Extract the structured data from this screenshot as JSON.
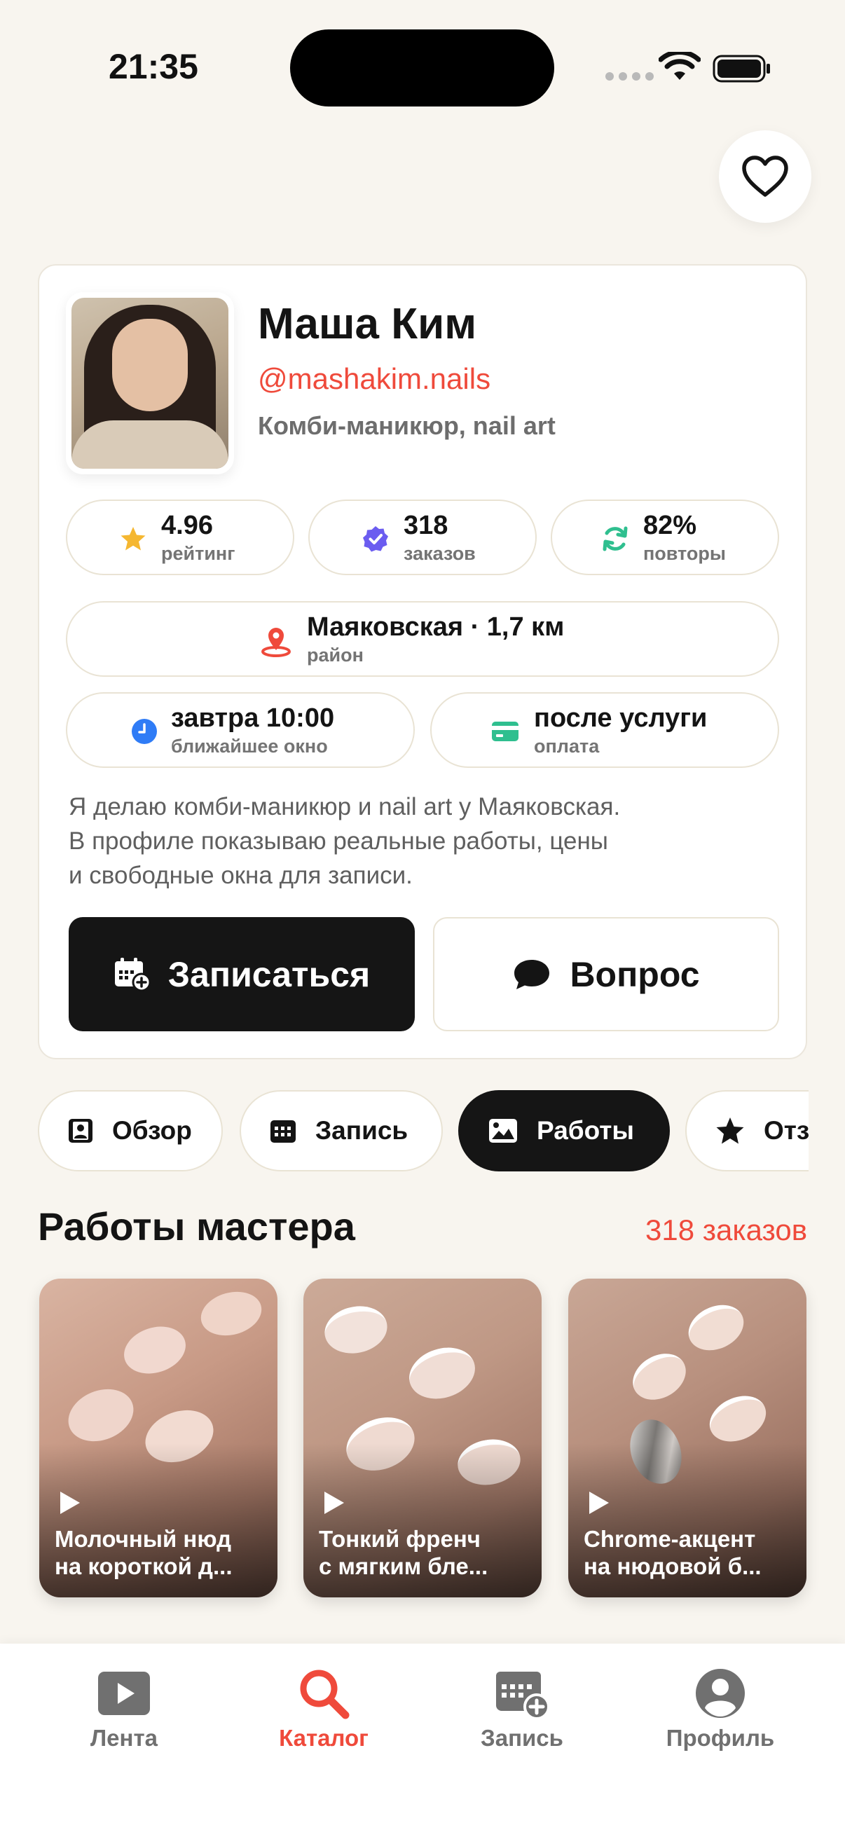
{
  "status_bar": {
    "time": "21:35"
  },
  "profile": {
    "name": "Маша Ким",
    "handle": "@mashakim.nails",
    "specialty": "Комби-маникюр, nail art",
    "stats": [
      {
        "value": "4.96",
        "caption": "рейтинг",
        "icon": "star-icon"
      },
      {
        "value": "318",
        "caption": "заказов",
        "icon": "verified-badge-icon"
      },
      {
        "value": "82%",
        "caption": "повторы",
        "icon": "repeat-icon"
      }
    ],
    "location": {
      "value": "Маяковская · 1,7 км",
      "caption": "район"
    },
    "nearest_slot": {
      "value": "завтра 10:00",
      "caption": "ближайшее окно"
    },
    "payment": {
      "value": "после услуги",
      "caption": "оплата"
    },
    "bio": [
      "Я делаю комби-маникюр и nail art у Маяковская.",
      "В профиле показываю реальные работы, цены",
      "и свободные окна для записи."
    ],
    "book_label": "Записаться",
    "ask_label": "Вопрос"
  },
  "tabs": [
    {
      "label": "Обзор",
      "icon": "profile-card-icon",
      "active": false
    },
    {
      "label": "Запись",
      "icon": "calendar-icon",
      "active": false
    },
    {
      "label": "Работы",
      "icon": "image-icon",
      "active": true
    },
    {
      "label": "Отзывы",
      "icon": "star-icon",
      "active": false
    }
  ],
  "works": {
    "title": "Работы мастера",
    "count": "318 заказов",
    "items": [
      {
        "line1": "Молочный нюд",
        "line2": "на короткой д..."
      },
      {
        "line1": "Тонкий френч",
        "line2": "с мягким бле..."
      },
      {
        "line1": "Chrome-акцент",
        "line2": "на нюдовой б..."
      }
    ]
  },
  "bottom_nav": [
    {
      "label": "Лента",
      "icon": "play-icon",
      "active": false
    },
    {
      "label": "Каталог",
      "icon": "search-icon",
      "active": true
    },
    {
      "label": "Запись",
      "icon": "calendar-add-icon",
      "active": false
    },
    {
      "label": "Профиль",
      "icon": "user-icon",
      "active": false
    }
  ],
  "colors": {
    "accent": "#ef4a3b",
    "dark": "#151515",
    "background": "#f8f5ef",
    "star": "#f5b731",
    "verified": "#6b5cf0",
    "repeat": "#2fbf8f",
    "clock": "#2f7cf6",
    "card": "#2fbf8f"
  }
}
